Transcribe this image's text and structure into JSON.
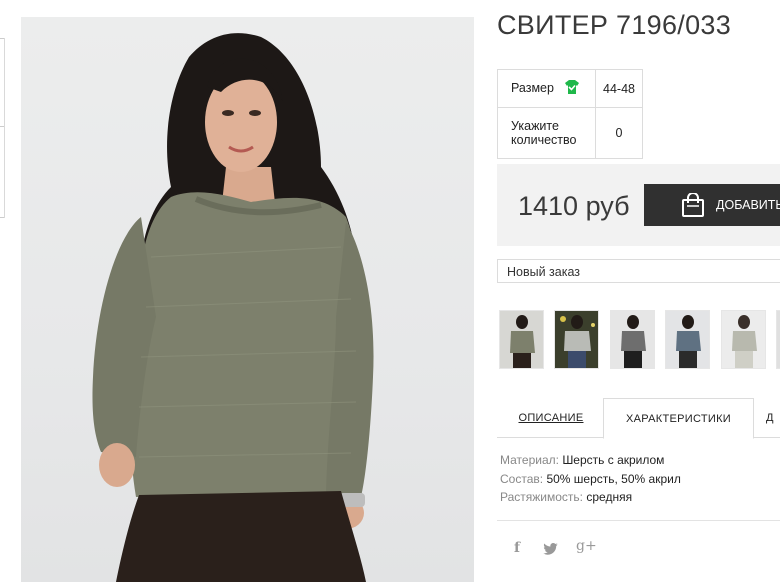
{
  "product": {
    "title": "СВИТЕР 7196/033",
    "price": "1410 руб"
  },
  "attributes": {
    "size_label": "Размер",
    "size_value": "44-48",
    "qty_label_line1": "Укажите",
    "qty_label_line2": "количество",
    "qty_value": "0"
  },
  "cart": {
    "add_label": "ДОБАВИТЬ"
  },
  "order": {
    "selected": "Новый заказ"
  },
  "tabs": {
    "description": "ОПИСАНИЕ",
    "characteristics": "ХАРАКТЕРИСТИКИ",
    "third_partial": "Д"
  },
  "specs": [
    {
      "key": "Материал:",
      "value": "Шерсть с акрилом"
    },
    {
      "key": "Состав:",
      "value": "50% шерсть, 50% акрил"
    },
    {
      "key": "Растяжимость:",
      "value": "средняя"
    }
  ],
  "social": {
    "facebook": "f",
    "twitter": "twitter-icon",
    "googleplus": "g+"
  },
  "colors": {
    "accent_green": "#1fb84a",
    "button_dark": "#303030",
    "price_bg": "#f2f2f2",
    "sweater_olive": "#7d806c"
  }
}
